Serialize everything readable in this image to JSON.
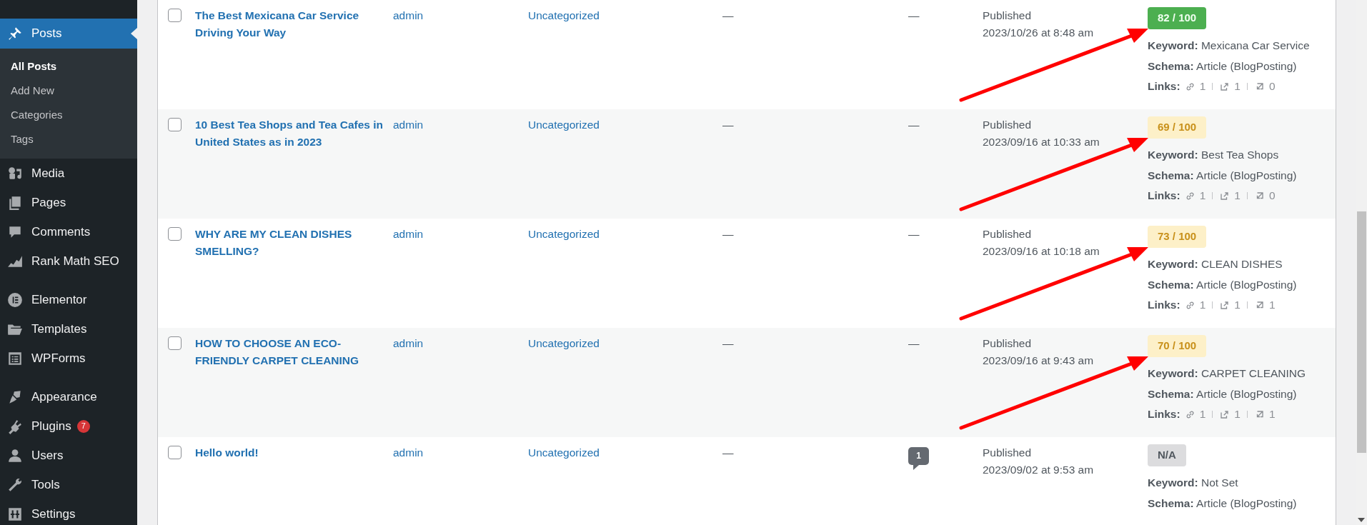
{
  "sidebar": {
    "active": {
      "label": "Posts",
      "selected": true,
      "submenu": [
        {
          "label": "All Posts",
          "selected": true
        },
        {
          "label": "Add New",
          "selected": false
        },
        {
          "label": "Categories",
          "selected": false
        },
        {
          "label": "Tags",
          "selected": false
        }
      ]
    },
    "groups": [
      [
        {
          "label": "Media"
        },
        {
          "label": "Pages"
        },
        {
          "label": "Comments"
        },
        {
          "label": "Rank Math SEO"
        }
      ],
      [
        {
          "label": "Elementor"
        },
        {
          "label": "Templates"
        },
        {
          "label": "WPForms"
        }
      ],
      [
        {
          "label": "Appearance"
        },
        {
          "label": "Plugins",
          "badge": "7"
        },
        {
          "label": "Users"
        },
        {
          "label": "Tools"
        },
        {
          "label": "Settings"
        }
      ]
    ]
  },
  "posts": [
    {
      "checked": false,
      "title": "The Best Mexicana Car Service Driving Your Way",
      "author": "admin",
      "category": "Uncategorized",
      "tags": "—",
      "comments": {
        "kind": "none",
        "text": "—"
      },
      "status": "Published",
      "date": "2023/10/26 at 8:48 am",
      "arrow": true,
      "seo": {
        "score": "82 / 100",
        "kind": "good",
        "keyword_label": "Keyword:",
        "keyword": "Mexicana Car Service",
        "schema_label": "Schema:",
        "schema": "Article (BlogPosting)",
        "links_label": "Links:",
        "links": [
          {
            "kind": "internal",
            "count": "1"
          },
          {
            "kind": "external",
            "count": "1"
          },
          {
            "kind": "incoming",
            "count": "0"
          }
        ]
      }
    },
    {
      "checked": false,
      "title": "10 Best Tea Shops and Tea Cafes in United States as in 2023",
      "author": "admin",
      "category": "Uncategorized",
      "tags": "—",
      "comments": {
        "kind": "none",
        "text": "—"
      },
      "status": "Published",
      "date": "2023/09/16 at 10:33 am",
      "arrow": true,
      "seo": {
        "score": "69 / 100",
        "kind": "ok",
        "keyword_label": "Keyword:",
        "keyword": "Best Tea Shops",
        "schema_label": "Schema:",
        "schema": "Article (BlogPosting)",
        "links_label": "Links:",
        "links": [
          {
            "kind": "internal",
            "count": "1"
          },
          {
            "kind": "external",
            "count": "1"
          },
          {
            "kind": "incoming",
            "count": "0"
          }
        ]
      }
    },
    {
      "checked": false,
      "title": "WHY ARE MY CLEAN DISHES SMELLING?",
      "author": "admin",
      "category": "Uncategorized",
      "tags": "—",
      "comments": {
        "kind": "none",
        "text": "—"
      },
      "status": "Published",
      "date": "2023/09/16 at 10:18 am",
      "arrow": true,
      "seo": {
        "score": "73 / 100",
        "kind": "ok",
        "keyword_label": "Keyword:",
        "keyword": "CLEAN DISHES",
        "schema_label": "Schema:",
        "schema": "Article (BlogPosting)",
        "links_label": "Links:",
        "links": [
          {
            "kind": "internal",
            "count": "1"
          },
          {
            "kind": "external",
            "count": "1"
          },
          {
            "kind": "incoming",
            "count": "1"
          }
        ]
      }
    },
    {
      "checked": false,
      "title": "HOW TO CHOOSE AN ECO-FRIENDLY CARPET CLEANING",
      "author": "admin",
      "category": "Uncategorized",
      "tags": "—",
      "comments": {
        "kind": "none",
        "text": "—"
      },
      "status": "Published",
      "date": "2023/09/16 at 9:43 am",
      "arrow": true,
      "seo": {
        "score": "70 / 100",
        "kind": "ok",
        "keyword_label": "Keyword:",
        "keyword": "CARPET CLEANING",
        "schema_label": "Schema:",
        "schema": "Article (BlogPosting)",
        "links_label": "Links:",
        "links": [
          {
            "kind": "internal",
            "count": "1"
          },
          {
            "kind": "external",
            "count": "1"
          },
          {
            "kind": "incoming",
            "count": "1"
          }
        ]
      }
    },
    {
      "checked": false,
      "title": "Hello world!",
      "author": "admin",
      "category": "Uncategorized",
      "tags": "—",
      "comments": {
        "kind": "bubble",
        "text": "1"
      },
      "status": "Published",
      "date": "2023/09/02 at 9:53 am",
      "arrow": false,
      "seo": {
        "score": "N/A",
        "kind": "none",
        "keyword_label": "Keyword:",
        "keyword": "Not Set",
        "schema_label": "Schema:",
        "schema": "Article (BlogPosting)"
      }
    }
  ]
}
